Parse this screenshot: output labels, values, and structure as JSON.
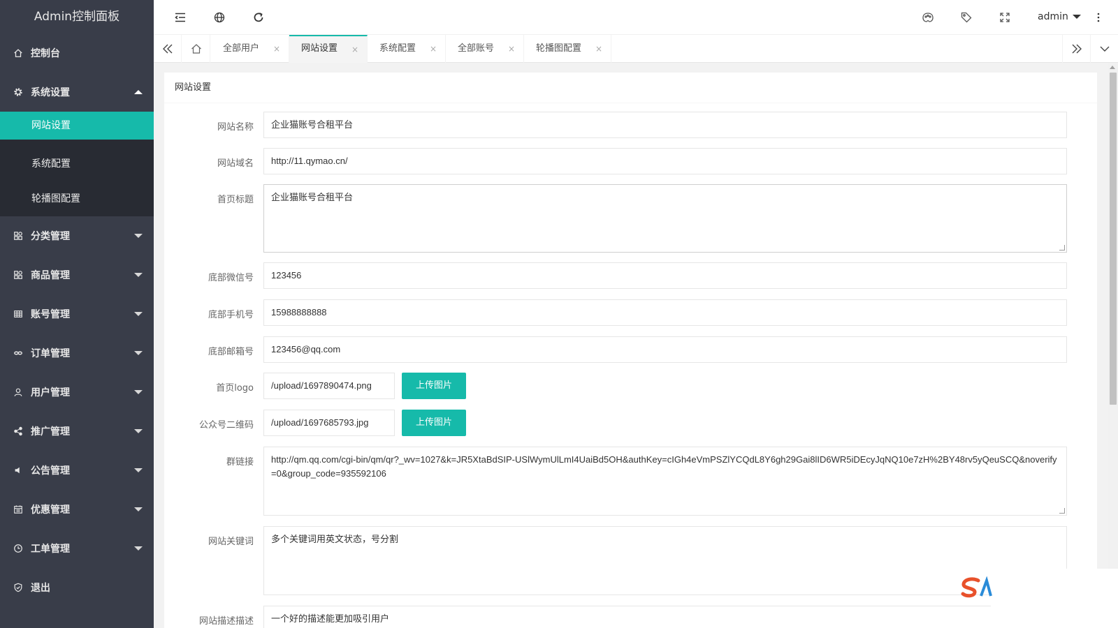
{
  "app": {
    "title": "Admin控制面板"
  },
  "sidebar": {
    "items": [
      {
        "label": "控制台",
        "icon": "home-icon"
      },
      {
        "label": "系统设置",
        "icon": "gear-icon",
        "expanded": true,
        "children": [
          {
            "label": "网站设置",
            "active": true
          },
          {
            "label": "系统配置"
          },
          {
            "label": "轮播图配置"
          }
        ]
      },
      {
        "label": "分类管理",
        "icon": "apps-icon"
      },
      {
        "label": "商品管理",
        "icon": "apps-icon"
      },
      {
        "label": "账号管理",
        "icon": "table-icon"
      },
      {
        "label": "订单管理",
        "icon": "link-icon"
      },
      {
        "label": "用户管理",
        "icon": "user-icon"
      },
      {
        "label": "推广管理",
        "icon": "share-icon"
      },
      {
        "label": "公告管理",
        "icon": "speaker-icon"
      },
      {
        "label": "优惠管理",
        "icon": "calendar-icon"
      },
      {
        "label": "工单管理",
        "icon": "clock-icon"
      },
      {
        "label": "退出",
        "icon": "shield-icon"
      }
    ]
  },
  "header": {
    "user": "admin",
    "icons": [
      "menu-fold-icon",
      "globe-icon",
      "refresh-icon",
      "theme-icon",
      "tag-icon",
      "fullscreen-icon",
      "more-vertical-icon"
    ]
  },
  "tabs": [
    {
      "label": "全部用户"
    },
    {
      "label": "网站设置",
      "active": true
    },
    {
      "label": "系统配置"
    },
    {
      "label": "全部账号"
    },
    {
      "label": "轮播图配置"
    }
  ],
  "tab_close_glyph": "×",
  "form": {
    "title": "网站设置",
    "upload_label": "上传图片",
    "fields": {
      "site_name": {
        "label": "网站名称",
        "value": "企业猫账号合租平台"
      },
      "site_domain": {
        "label": "网站域名",
        "value": "http://11.qymao.cn/"
      },
      "home_title": {
        "label": "首页标题",
        "value": "企业猫账号合租平台"
      },
      "footer_wechat": {
        "label": "底部微信号",
        "value": "123456"
      },
      "footer_phone": {
        "label": "底部手机号",
        "value": "15988888888"
      },
      "footer_email": {
        "label": "底部邮箱号",
        "value": "123456@qq.com"
      },
      "home_logo": {
        "label": "首页logo",
        "value": "/upload/1697890474.png"
      },
      "qrcode": {
        "label": "公众号二维码",
        "value": "/upload/1697685793.jpg"
      },
      "group_link": {
        "label": "群链接",
        "value": "http://qm.qq.com/cgi-bin/qm/qr?_wv=1027&k=JR5XtaBdSIP-USlWymUlLmI4UaiBd5OH&authKey=cIGh4eVmPSZlYCQdL8Y6gh29Gai8lID6WR5iDEcyJqNQ10e7zH%2BY48rv5yQeuSCQ&noverify=0&group_code=935592106"
      },
      "keywords": {
        "label": "网站关键词",
        "value": "多个关键词用英文状态，号分割"
      },
      "description": {
        "label": "网站描述描述",
        "value": "一个好的描述能更加吸引用户"
      }
    }
  },
  "colors": {
    "accent": "#16baaa",
    "sidebar_bg": "#393d49",
    "submenu_bg": "#282b33"
  }
}
